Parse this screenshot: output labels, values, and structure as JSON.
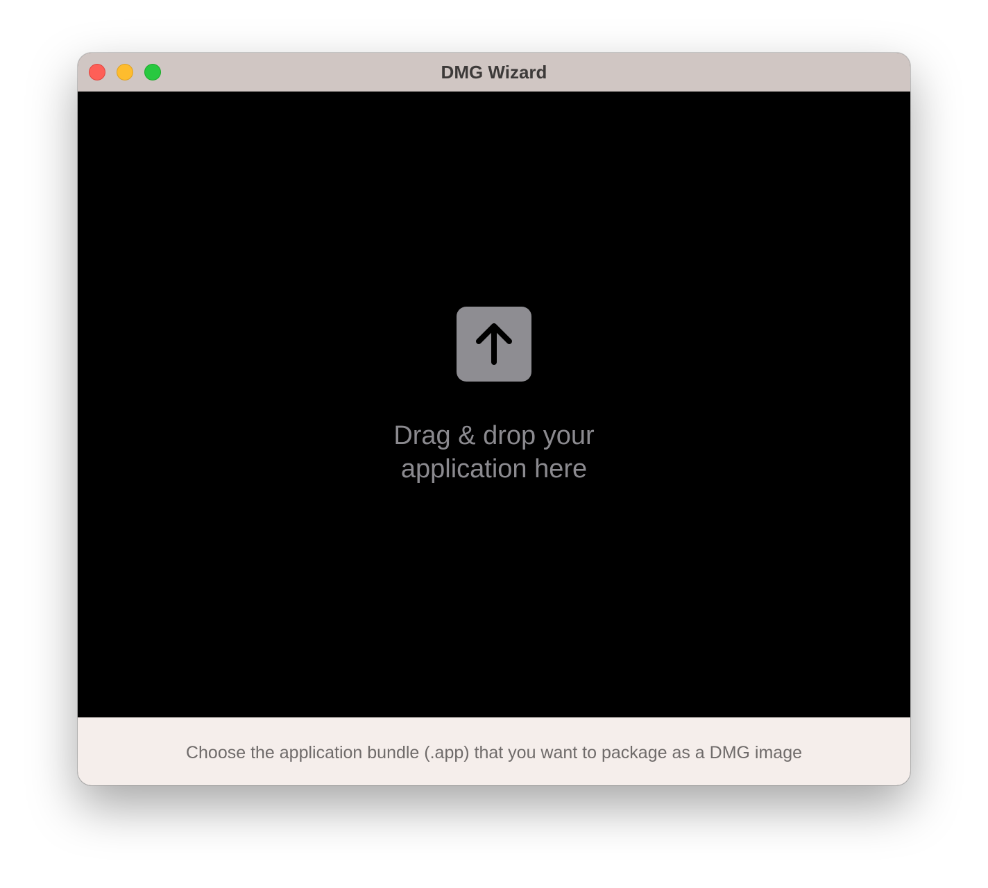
{
  "window": {
    "title": "DMG Wizard",
    "controls": [
      "close",
      "minimize",
      "zoom"
    ]
  },
  "drop_zone": {
    "icon": "arrow-up-square-icon",
    "line1": "Drag & drop your",
    "line2": "application here"
  },
  "footer": {
    "hint": "Choose the application bundle (.app) that you want to package as a DMG image"
  },
  "colors": {
    "titlebar": "#d0c6c3",
    "content_background": "#000000",
    "footer_background": "#f5eeeb",
    "icon_tile": "#8e8d92",
    "close": "#fe5f57",
    "minimize": "#febc2e",
    "zoom": "#28c840"
  }
}
